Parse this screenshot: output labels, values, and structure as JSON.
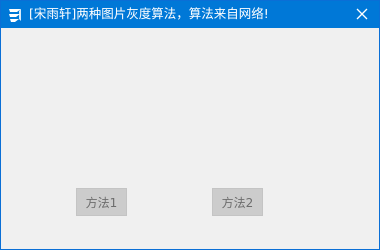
{
  "window": {
    "title": "[宋雨轩]两种图片灰度算法，算法来自网络!",
    "accent_color": "#0078d7",
    "icons": {
      "app": "app-logo-icon",
      "close": "close-icon"
    }
  },
  "buttons": {
    "method1_label": "方法1",
    "method2_label": "方法2"
  }
}
